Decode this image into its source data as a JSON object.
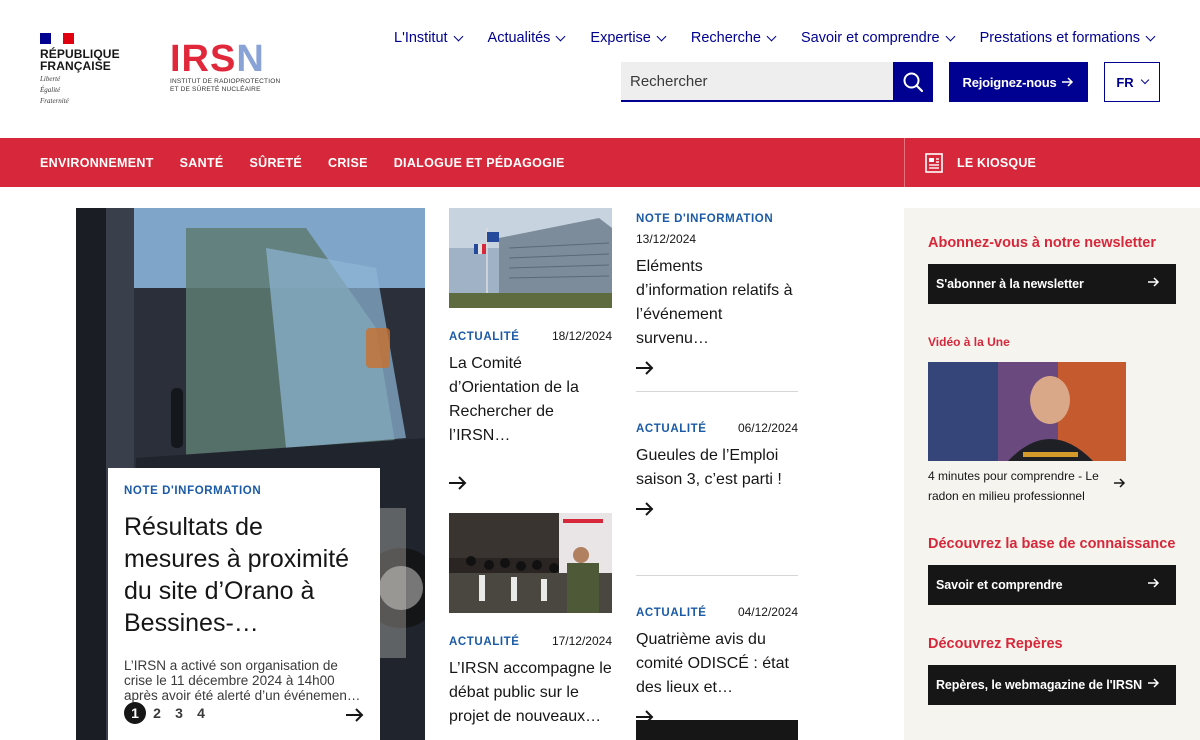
{
  "header": {
    "republique": [
      "RÉPUBLIQUE",
      "FRANÇAISE"
    ],
    "motto": [
      "Liberté",
      "Égalité",
      "Fraternité"
    ],
    "logo_word": "IRSN",
    "logo_sub": [
      "INSTITUT DE RADIOPROTECTION",
      "ET DE SÛRETÉ NUCLÉAIRE"
    ],
    "nav": [
      "L'Institut",
      "Actualités",
      "Expertise",
      "Recherche",
      "Savoir et comprendre",
      "Prestations et formations"
    ],
    "search_placeholder": "Rechercher",
    "join_label": "Rejoignez-nous",
    "lang": "FR"
  },
  "categories": [
    "ENVIRONNEMENT",
    "SANTÉ",
    "SÛRETÉ",
    "CRISE",
    "DIALOGUE ET PÉDAGOGIE"
  ],
  "kiosk_label": "LE KIOSQUE",
  "hero": {
    "tag": "NOTE D'INFORMATION",
    "title": "Résultats de mesures à proximité du site d’Orano à Bessines-…",
    "desc": "L’IRSN a activé son organisation de crise le 11 décembre 2024 à 14h00 après avoir été alerté d’un événemen…",
    "pages": [
      "1",
      "2",
      "3",
      "4"
    ],
    "current_page": "1"
  },
  "col2": [
    {
      "tag": "ACTUALITÉ",
      "date": "18/12/2024",
      "title": "La Comité d’Orientation de la Rechercher de l’IRSN…"
    },
    {
      "tag": "ACTUALITÉ",
      "date": "17/12/2024",
      "title": "L’IRSN accompagne le débat public sur le projet de nouveaux…"
    }
  ],
  "col3": [
    {
      "tag": "NOTE D'INFORMATION",
      "date": "13/12/2024",
      "title": "Eléments d’information relatifs à l’événement survenu…"
    },
    {
      "tag": "ACTUALITÉ",
      "date": "06/12/2024",
      "title": "Gueules de l’Emploi saison 3, c’est parti !"
    },
    {
      "tag": "ACTUALITÉ",
      "date": "04/12/2024",
      "title": "Quatrième avis du comité ODISCÉ : état des lieux et…"
    }
  ],
  "sidebar": {
    "newsletter_heading": "Abonnez-vous à notre newsletter",
    "newsletter_button": "S'abonner à la newsletter",
    "video_heading": "Vidéo à la Une",
    "video_caption": "4 minutes pour comprendre - Le radon en milieu professionnel",
    "knowledge_heading": "Découvrez la base de connaissance",
    "knowledge_button": "Savoir et comprendre",
    "reperes_heading": "Découvrez Repères",
    "reperes_button": "Repères, le webmagazine de l'IRSN"
  },
  "colors": {
    "brand_blue": "#000091",
    "irsn_red": "#d6283a",
    "tag_blue": "#1a5aa6",
    "dark": "#161616",
    "sidebar_bg": "#f6f4ef"
  }
}
